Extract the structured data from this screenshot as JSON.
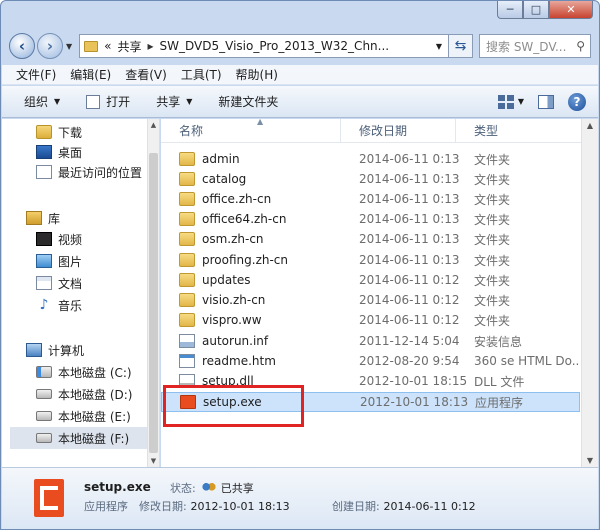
{
  "titlebar": {
    "minimize": "─",
    "maximize": "□",
    "close": "✕"
  },
  "address": {
    "overflow": "«",
    "crumbs": [
      "共享",
      "SW_DVD5_Visio_Pro_2013_W32_Chn..."
    ],
    "search_placeholder": "搜索 SW_DV..."
  },
  "menu": [
    "文件(F)",
    "编辑(E)",
    "查看(V)",
    "工具(T)",
    "帮助(H)"
  ],
  "toolbar": {
    "organize": "组织",
    "open": "打开",
    "share": "共享",
    "new_folder": "新建文件夹"
  },
  "nav": {
    "favorites": [
      "下载",
      "桌面",
      "最近访问的位置"
    ],
    "library": {
      "label": "库",
      "items": [
        "视频",
        "图片",
        "文档",
        "音乐"
      ]
    },
    "computer": {
      "label": "计算机",
      "items": [
        "本地磁盘 (C:)",
        "本地磁盘 (D:)",
        "本地磁盘 (E:)",
        "本地磁盘 (F:)"
      ]
    }
  },
  "columns": {
    "name": "名称",
    "date": "修改日期",
    "type": "类型"
  },
  "files": [
    {
      "name": "admin",
      "date": "2014-06-11 0:13",
      "type": "文件夹",
      "icon": "folder"
    },
    {
      "name": "catalog",
      "date": "2014-06-11 0:13",
      "type": "文件夹",
      "icon": "folder"
    },
    {
      "name": "office.zh-cn",
      "date": "2014-06-11 0:13",
      "type": "文件夹",
      "icon": "folder"
    },
    {
      "name": "office64.zh-cn",
      "date": "2014-06-11 0:13",
      "type": "文件夹",
      "icon": "folder"
    },
    {
      "name": "osm.zh-cn",
      "date": "2014-06-11 0:13",
      "type": "文件夹",
      "icon": "folder"
    },
    {
      "name": "proofing.zh-cn",
      "date": "2014-06-11 0:13",
      "type": "文件夹",
      "icon": "folder"
    },
    {
      "name": "updates",
      "date": "2014-06-11 0:12",
      "type": "文件夹",
      "icon": "folder"
    },
    {
      "name": "visio.zh-cn",
      "date": "2014-06-11 0:12",
      "type": "文件夹",
      "icon": "folder"
    },
    {
      "name": "vispro.ww",
      "date": "2014-06-11 0:12",
      "type": "文件夹",
      "icon": "folder"
    },
    {
      "name": "autorun.inf",
      "date": "2011-12-14 5:04",
      "type": "安装信息",
      "icon": "inf"
    },
    {
      "name": "readme.htm",
      "date": "2012-08-20 9:54",
      "type": "360 se HTML Do...",
      "icon": "htm"
    },
    {
      "name": "setup.dll",
      "date": "2012-10-01 18:15",
      "type": "DLL 文件",
      "icon": "dll"
    },
    {
      "name": "setup.exe",
      "date": "2012-10-01 18:13",
      "type": "应用程序",
      "icon": "office"
    }
  ],
  "details": {
    "name": "setup.exe",
    "type": "应用程序",
    "status_label": "状态:",
    "status_value": "已共享",
    "modified_label": "修改日期:",
    "modified_value": "2012-10-01 18:13",
    "created_label": "创建日期:",
    "created_value": "2014-06-11 0:12"
  },
  "colors": {
    "highlight": "#e02323",
    "selection": "#cce3fb",
    "accent": "#2b5797"
  }
}
